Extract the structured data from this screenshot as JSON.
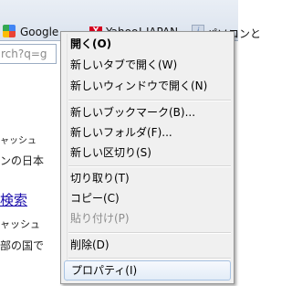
{
  "bookmarks": {
    "items": [
      {
        "label": "Google"
      },
      {
        "label": "Yahoo! JAPAN"
      },
      {
        "label": "パソコンと"
      }
    ],
    "yahoo_icon_letter": "Y",
    "info_icon_letter": "i"
  },
  "urlbar": {
    "value": "rch?q=g"
  },
  "page": {
    "lines": [
      "ャッシュ",
      "ンの日本",
      "検索",
      "ャッシュ",
      "部の国で"
    ]
  },
  "context_menu": {
    "items": [
      {
        "label": "開く(O)"
      },
      {
        "label": "新しいタブで開く(W)"
      },
      {
        "label": "新しいウィンドウで開く(N)"
      },
      {
        "label": "新しいブックマーク(B)..."
      },
      {
        "label": "新しいフォルダ(F)..."
      },
      {
        "label": "新しい区切り(S)"
      },
      {
        "label": "切り取り(T)"
      },
      {
        "label": "コピー(C)"
      },
      {
        "label": "貼り付け(P)"
      },
      {
        "label": "削除(D)"
      },
      {
        "label": "プロパティ(I)"
      }
    ]
  }
}
